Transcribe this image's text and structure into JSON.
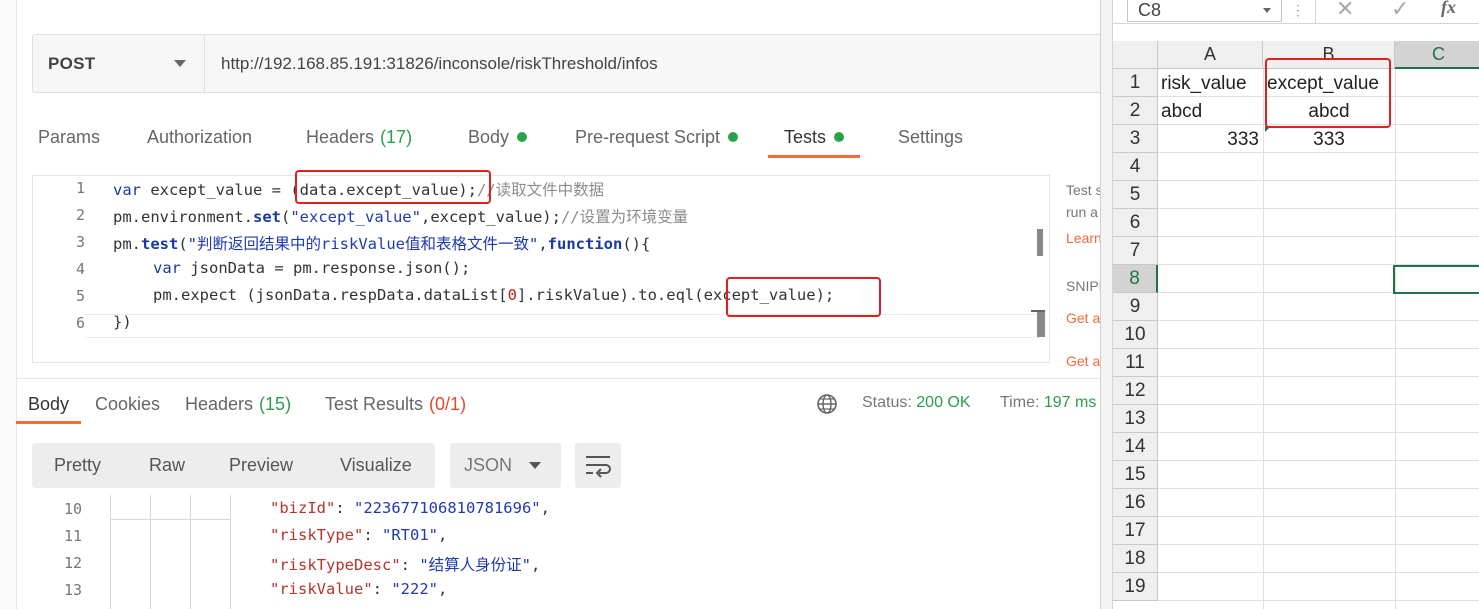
{
  "request": {
    "method": "POST",
    "url": "http://192.168.85.191:31826/inconsole/riskThreshold/infos"
  },
  "request_tabs": [
    {
      "label": "Params"
    },
    {
      "label": "Authorization"
    },
    {
      "label": "Headers",
      "count": "(17)"
    },
    {
      "label": "Body"
    },
    {
      "label": "Pre-request Script"
    },
    {
      "label": "Tests"
    },
    {
      "label": "Settings"
    }
  ],
  "active_request_tab": "Tests",
  "script": {
    "line_numbers": [
      "1",
      "2",
      "3",
      "4",
      "5",
      "6"
    ],
    "l1": {
      "kw": "var",
      "a": " except_value = ",
      "b": "(data.except_value)",
      "c": ";",
      "comment": "//读取文件中数据"
    },
    "l2": {
      "a": "pm.environment.",
      "fn": "set",
      "b": "(",
      "str": "\"except_value\"",
      "c": ",except_value);",
      "comment": "//设置为环境变量"
    },
    "l3": {
      "a": "pm.",
      "fn": "test",
      "b": "(",
      "str": "\"判断返回结果中的riskValue值和表格文件一致\"",
      "c": ",",
      "kw": "function",
      "d": "(){"
    },
    "l4": {
      "kw": "var",
      "a": " jsonData = pm.response.json();"
    },
    "l5": {
      "a": "pm.expect (jsonData.respData.dataList[",
      "num": "0",
      "b": "].riskValue).to.eql",
      "c": "(except_value);"
    },
    "l6": {
      "a": "})"
    }
  },
  "snippets": {
    "l1": "Test s",
    "l2": "run a",
    "l3": "Learn",
    "l4": "SNIPP",
    "l5": "Get a",
    "l6": "Get a"
  },
  "response_tabs": [
    {
      "label": "Body"
    },
    {
      "label": "Cookies"
    },
    {
      "label": "Headers",
      "count": "(15)"
    },
    {
      "label": "Test Results",
      "count": "(0/1)"
    }
  ],
  "status": {
    "label": "Status:",
    "value": "200 OK",
    "time_label": "Time:",
    "time_value": "197 ms"
  },
  "view_modes": [
    "Pretty",
    "Raw",
    "Preview",
    "Visualize"
  ],
  "format": "JSON",
  "response_body": {
    "line_numbers": [
      "10",
      "11",
      "12",
      "13"
    ],
    "lines": [
      {
        "key": "\"bizId\"",
        "value": "\"223677106810781696\"",
        "end": ","
      },
      {
        "key": "\"riskType\"",
        "value": "\"RT01\"",
        "end": ","
      },
      {
        "key": "\"riskTypeDesc\"",
        "value": "\"结算人身份证\"",
        "end": ","
      },
      {
        "key": "\"riskValue\"",
        "value": "\"222\"",
        "end": ","
      }
    ]
  },
  "excel": {
    "name_box": "C8",
    "columns": [
      "A",
      "B",
      "C"
    ],
    "rows": [
      "1",
      "2",
      "3",
      "4",
      "5",
      "6",
      "7",
      "8",
      "9",
      "10",
      "11",
      "12",
      "13",
      "14",
      "15",
      "16",
      "17",
      "18",
      "19"
    ],
    "cells": {
      "A1": "risk_value",
      "B1": "except_value",
      "A2": "abcd",
      "B2": "abcd",
      "A3": "333",
      "B3": "333"
    },
    "active_cell": "C8"
  },
  "colors": {
    "accent": "#f26b3a",
    "success": "#2d9e4c",
    "highlight_box": "#e02020",
    "excel_green": "#217346"
  }
}
